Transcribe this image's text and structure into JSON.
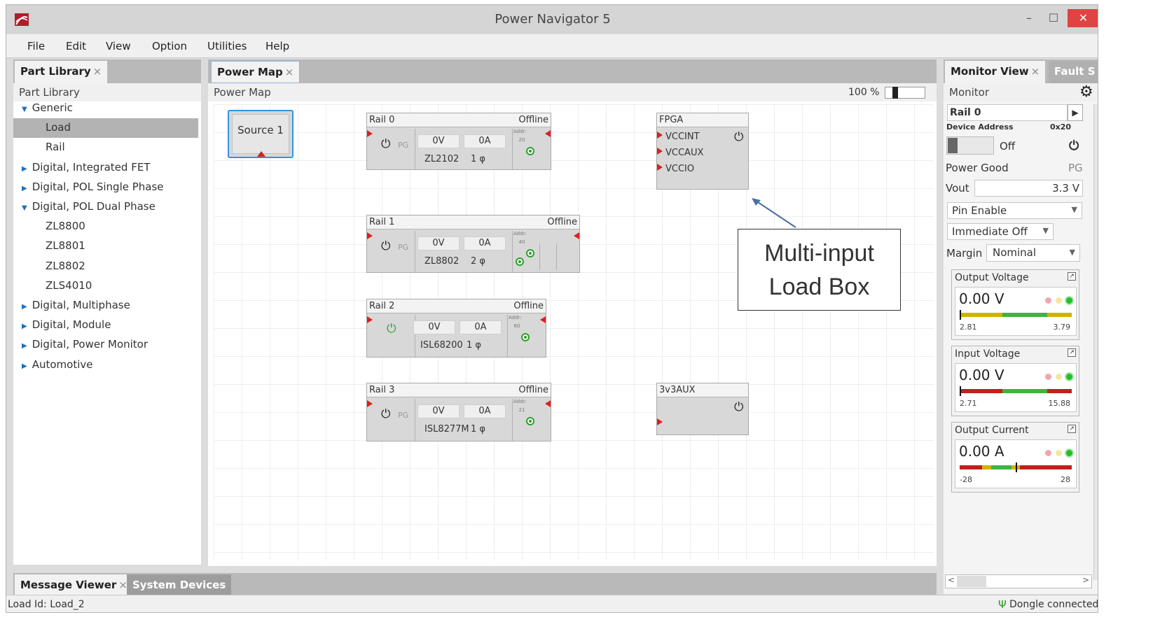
{
  "window": {
    "title": "Power Navigator 5",
    "minimize": "–",
    "maximize": "☐",
    "close": "✕"
  },
  "menu": [
    "File",
    "Edit",
    "View",
    "Option",
    "Utilities",
    "Help"
  ],
  "part_library": {
    "tab": "Part Library",
    "close": "×",
    "header": "Part Library",
    "items": [
      {
        "label": "Generic",
        "state": "expanded"
      },
      {
        "label": "Load",
        "state": "child",
        "selected": true
      },
      {
        "label": "Rail",
        "state": "child"
      },
      {
        "label": "Digital, Integrated FET",
        "state": "collapsed"
      },
      {
        "label": "Digital, POL Single Phase",
        "state": "collapsed"
      },
      {
        "label": "Digital, POL Dual Phase",
        "state": "expanded"
      },
      {
        "label": "ZL8800",
        "state": "child"
      },
      {
        "label": "ZL8801",
        "state": "child"
      },
      {
        "label": "ZL8802",
        "state": "child"
      },
      {
        "label": "ZLS4010",
        "state": "child"
      },
      {
        "label": "Digital, Multiphase",
        "state": "collapsed"
      },
      {
        "label": "Digital, Module",
        "state": "collapsed"
      },
      {
        "label": "Digital, Power Monitor",
        "state": "collapsed"
      },
      {
        "label": "Automotive",
        "state": "collapsed"
      }
    ]
  },
  "power_map": {
    "tab": "Power Map",
    "close": "×",
    "header": "Power Map",
    "zoom": "100 %",
    "source": {
      "label": "Source 1"
    },
    "rails": [
      {
        "name": "Rail 0",
        "status": "Offline",
        "voltage": "0V",
        "current": "0A",
        "part": "ZL2102",
        "phase": "1 φ",
        "addr_label": "Addr:",
        "addr": "20",
        "pg": "PG"
      },
      {
        "name": "Rail 1",
        "status": "Offline",
        "voltage": "0V",
        "current": "0A",
        "part": "ZL8802",
        "phase": "2 φ",
        "addr_label": "Addr:",
        "addr": "40",
        "pg": "PG"
      },
      {
        "name": "Rail 2",
        "status": "Offline",
        "voltage": "0V",
        "current": "0A",
        "part": "ISL68200",
        "phase": "1 φ",
        "addr_label": "Addr:",
        "addr": "60",
        "pg": ""
      },
      {
        "name": "Rail 3",
        "status": "Offline",
        "voltage": "0V",
        "current": "0A",
        "part": "ISL8277M",
        "phase": "1 φ",
        "addr_label": "Addr:",
        "addr": "21",
        "pg": "PG"
      }
    ],
    "loads": [
      {
        "name": "FPGA",
        "inputs": [
          "VCCINT",
          "VCCAUX",
          "VCCIO"
        ]
      },
      {
        "name": "3v3AUX",
        "inputs": []
      }
    ],
    "callout": {
      "line1": "Multi-input",
      "line2": "Load Box"
    }
  },
  "monitor": {
    "tabs": [
      "Monitor View",
      "Fault S"
    ],
    "close": "×",
    "header": "Monitor",
    "rail": "Rail 0",
    "device_address_label": "Device Address",
    "device_address": "0x20",
    "toggle": "Off",
    "power_good_label": "Power Good",
    "power_good": "PG",
    "vout_label": "Vout",
    "vout": "3.3 V",
    "pin_enable": "Pin Enable",
    "immediate_off": "Immediate Off",
    "margin_label": "Margin",
    "margin": "Nominal",
    "gauges": [
      {
        "title": "Output Voltage",
        "value": "0.00 V",
        "min": "2.81",
        "max": "3.79",
        "colors": [
          "#d4b000",
          "#3cb540",
          "#d4b000"
        ]
      },
      {
        "title": "Input Voltage",
        "value": "0.00 V",
        "min": "2.71",
        "max": "15.88",
        "colors": [
          "#c21f1f",
          "#3cb540",
          "#c21f1f"
        ]
      },
      {
        "title": "Output Current",
        "value": "0.00 A",
        "min": "-28",
        "max": "28",
        "colors": [
          "#c21f1f",
          "#d4b000",
          "#3cb540",
          "#d4b000",
          "#c21f1f"
        ]
      }
    ]
  },
  "bottom": {
    "tabs": [
      "Message Viewer",
      "System Devices"
    ],
    "close": "×",
    "status_left": "Load Id: Load_2",
    "status_right": "Dongle connected"
  }
}
